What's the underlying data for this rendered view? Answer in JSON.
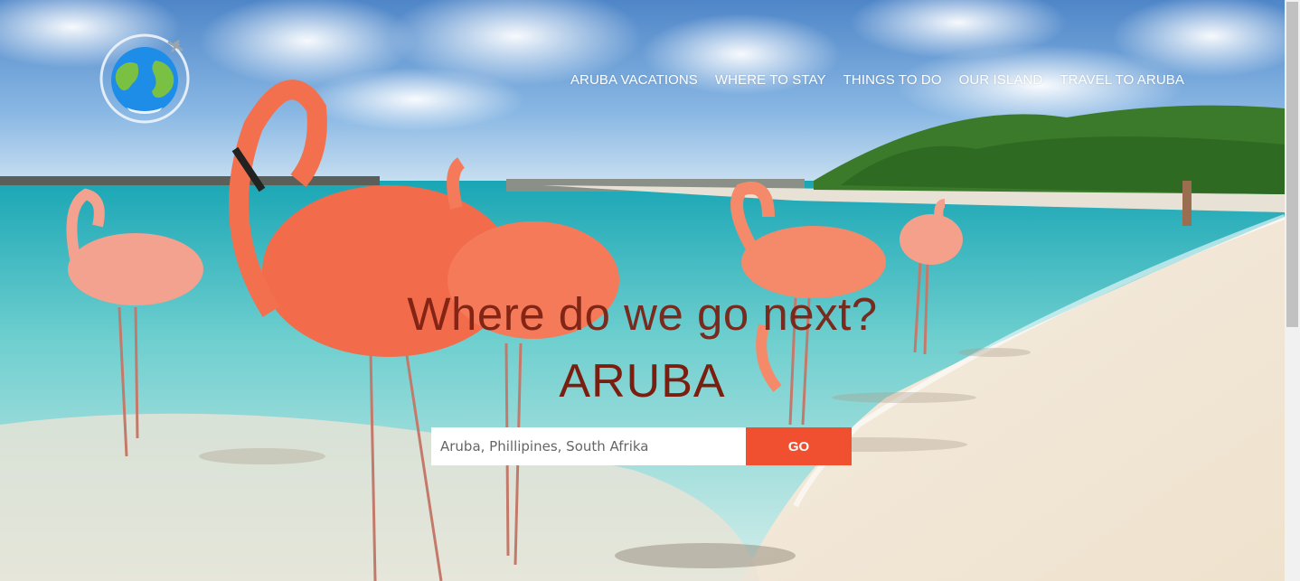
{
  "nav": {
    "items": [
      {
        "label": "ARUBA VACATIONS"
      },
      {
        "label": "WHERE TO STAY"
      },
      {
        "label": "THINGS TO DO"
      },
      {
        "label": "OUR ISLAND"
      },
      {
        "label": "TRAVEL TO ARUBA"
      }
    ]
  },
  "hero": {
    "headline": "Where do we go next?",
    "destination": "ARUBA"
  },
  "search": {
    "placeholder": "Aruba, Phillipines, South Afrika",
    "button_label": "GO"
  },
  "logo": {
    "icon": "globe-airplane-icon"
  },
  "colors": {
    "accent": "#f05030",
    "headline": "#7a1e10",
    "nav_text": "#ffffff"
  }
}
